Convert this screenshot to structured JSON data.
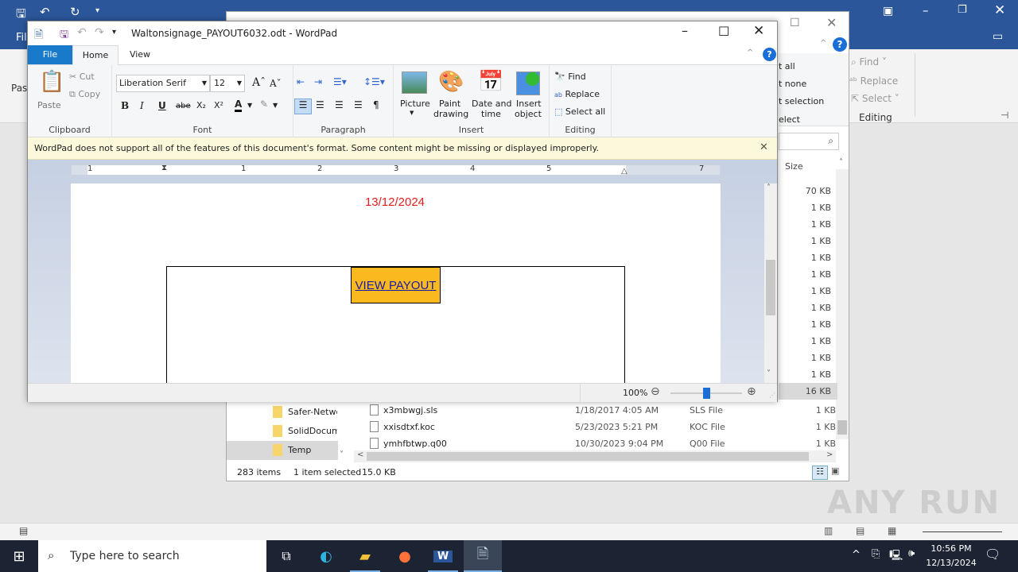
{
  "word_bg": {
    "file_tab": "Fil",
    "paste": "Pas",
    "editing": {
      "find": "Find",
      "replace": "Replace",
      "select": "Select",
      "group": "Editing"
    }
  },
  "explorer": {
    "ribbon": {
      "select_all": "t all",
      "select_none": "t none",
      "invert": "t selection",
      "select": "elect"
    },
    "size_header": "Size",
    "sizes": [
      "70 KB",
      "1 KB",
      "1 KB",
      "1 KB",
      "1 KB",
      "1 KB",
      "1 KB",
      "1 KB",
      "1 KB",
      "1 KB",
      "1 KB",
      "1 KB",
      "16 KB"
    ],
    "nav": [
      {
        "label": "Safer-Netwo"
      },
      {
        "label": "SolidDocum"
      },
      {
        "label": "Temp",
        "selected": true
      }
    ],
    "files": [
      {
        "name": "x3mbwgj.sls",
        "date": "1/18/2017 4:05 AM",
        "type": "SLS File",
        "size": "1 KB"
      },
      {
        "name": "xxisdtxf.koc",
        "date": "5/23/2023 5:21 PM",
        "type": "KOC File",
        "size": "1 KB"
      },
      {
        "name": "ymhfbtwp.q00",
        "date": "10/30/2023 9:04 PM",
        "type": "Q00 File",
        "size": "1 KB"
      }
    ],
    "status": {
      "items": "283 items",
      "selected": "1 item selected",
      "size": "15.0 KB"
    }
  },
  "wordpad": {
    "title": "Waltonsignage_PAYOUT6032.odt - WordPad",
    "tabs": [
      {
        "label": "File"
      },
      {
        "label": "Home"
      },
      {
        "label": "View"
      }
    ],
    "clipboard": {
      "paste": "Paste",
      "cut": "Cut",
      "copy": "Copy",
      "group": "Clipboard"
    },
    "font": {
      "family": "Liberation Serif",
      "size": "12",
      "group": "Font"
    },
    "paragraph": {
      "group": "Paragraph"
    },
    "insert": {
      "picture": "Picture",
      "paint1": "Paint",
      "paint2": "drawing",
      "date1": "Date and",
      "date2": "time",
      "obj1": "Insert",
      "obj2": "object",
      "group": "Insert"
    },
    "editing": {
      "find": "Find",
      "replace": "Replace",
      "select_all": "Select all",
      "group": "Editing"
    },
    "notification": "WordPad does not support all of the features of this document's format. Some content might be missing or displayed improperly.",
    "ruler_numbers": [
      "1",
      "1",
      "2",
      "3",
      "4",
      "5",
      "7"
    ],
    "document": {
      "date": "13/12/2024",
      "button": "VIEW PAYOUT",
      "date_color": "#e02020",
      "button_color": "#f9b91f"
    },
    "zoom": "100%",
    "zoom_level_percent": 100
  },
  "taskbar": {
    "search_placeholder": "Type here to search",
    "time": "10:56 PM",
    "date": "12/13/2024"
  },
  "watermark": "ANY RUN"
}
